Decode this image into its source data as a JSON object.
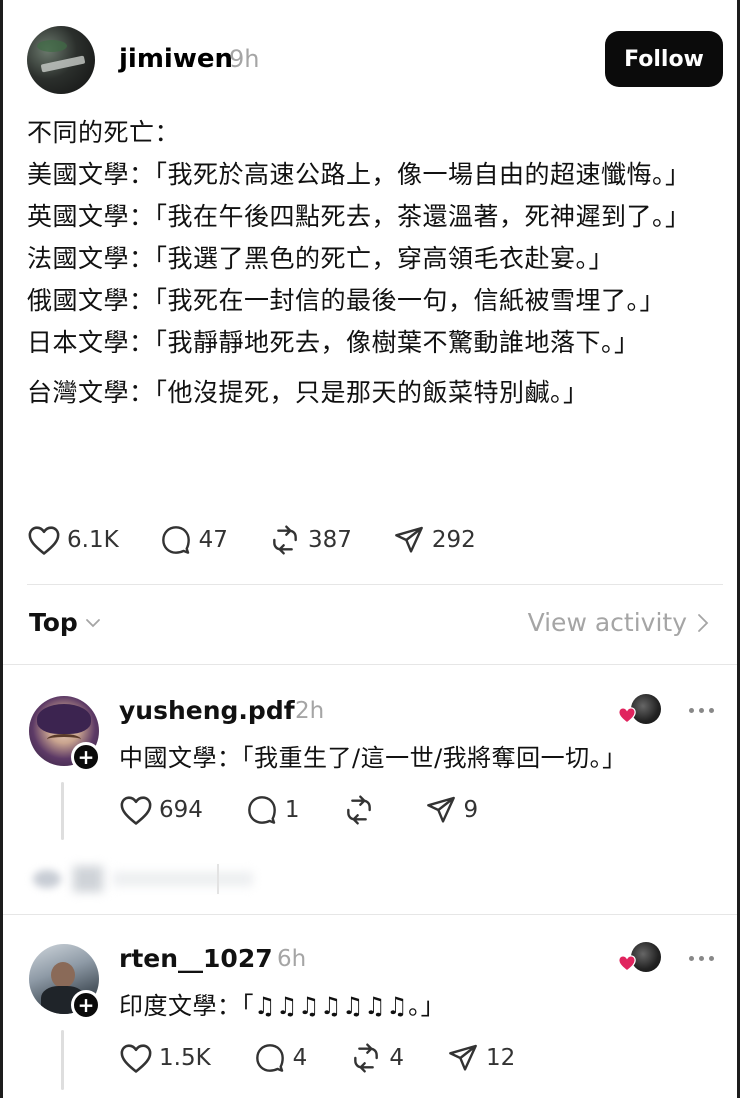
{
  "post": {
    "username": "jimiwen",
    "time": "9h",
    "follow_label": "Follow",
    "lines": [
      "不同的死亡：",
      "美國文學：「我死於高速公路上，像一場自由的超速懺悔。」",
      "英國文學：「我在午後四點死去，茶還溫著，死神遲到了。」",
      "法國文學：「我選了黑色的死亡，穿高領毛衣赴宴。」",
      "俄國文學：「我死在一封信的最後一句，信紙被雪埋了。」",
      "日本文學：「我靜靜地死去，像樹葉不驚動誰地落下。」",
      "台灣文學：「他沒提死，只是那天的飯菜特別鹹。」"
    ],
    "likes": "6.1K",
    "comments": "47",
    "reposts": "387",
    "shares": "292"
  },
  "sort": {
    "label": "Top",
    "view_activity": "View activity"
  },
  "replies": [
    {
      "username": "yusheng.pdf",
      "time": "2h",
      "text": "中國文學：「我重生了/這一世/我將奪回一切。」",
      "likes": "694",
      "comments": "1",
      "reposts": "",
      "shares": "9"
    },
    {
      "username": "rten__1027",
      "time": "6h",
      "text": "印度文學：「♫♫♫♫♫♫♫。」",
      "likes": "1.5K",
      "comments": "4",
      "reposts": "4",
      "shares": "12"
    }
  ],
  "icons": {
    "like": "heart-icon",
    "comment": "comment-bubble-icon",
    "repost": "repost-icon",
    "share": "share-arrow-icon",
    "more": "more-dots-icon",
    "chevron_down": "chevron-down-icon",
    "chevron_right": "chevron-right-icon",
    "plus": "plus-icon"
  },
  "colors": {
    "follow_bg": "#0b0b0b",
    "muted_text": "#a5a5a5",
    "liked_heart": "#e0245e"
  }
}
